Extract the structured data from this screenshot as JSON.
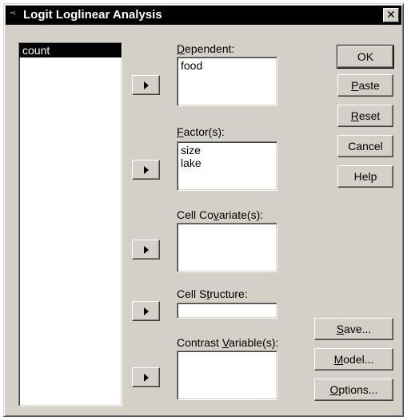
{
  "window": {
    "title": "Logit Loglinear Analysis",
    "close_glyph": "✕"
  },
  "source_list": {
    "items": [
      "count"
    ],
    "selected": "count"
  },
  "fields": {
    "dependent": {
      "label_u": "D",
      "label_rest": "ependent:",
      "values": [
        "food"
      ]
    },
    "factors": {
      "label_u": "F",
      "label_rest": "actor(s):",
      "values": [
        "size",
        "lake"
      ]
    },
    "cell_covariates": {
      "label_pre": "Cell Co",
      "label_u": "v",
      "label_rest": "ariate(s):",
      "values": []
    },
    "cell_structure": {
      "label_pre": "Cell S",
      "label_u": "t",
      "label_rest": "ructure:",
      "value": ""
    },
    "contrast_variables": {
      "label_pre": "Contrast ",
      "label_u": "V",
      "label_rest": "ariable(s):",
      "values": []
    }
  },
  "buttons": {
    "ok": "OK",
    "paste_u": "P",
    "paste_rest": "aste",
    "reset_u": "R",
    "reset_rest": "eset",
    "cancel": "Cancel",
    "help": "Help",
    "save_u": "S",
    "save_rest": "ave...",
    "model_u": "M",
    "model_rest": "odel...",
    "options_u": "O",
    "options_rest": "ptions..."
  },
  "icons": {
    "move_arrow": "right-triangle-icon",
    "title_icon": "spss-dialog-icon"
  }
}
